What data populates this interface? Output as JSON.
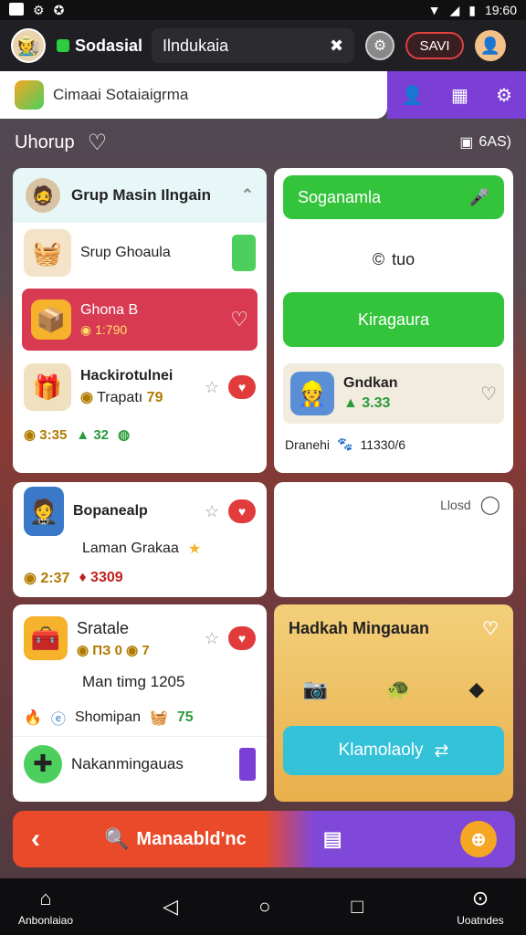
{
  "status": {
    "time": "19:60"
  },
  "appbar": {
    "brand": "Sodasial",
    "search_value": "Ilndukaia",
    "save_label": "SAVI"
  },
  "subbar": {
    "title": "Cimaai Sotaiaigrma"
  },
  "group_row": {
    "label": "Uhorup",
    "count": "6AS)"
  },
  "card1": {
    "header": "Grup Masin Ilngain",
    "row1": "Srup Ghoaula",
    "row2_title": "Ghona B",
    "row2_coin": "1:790",
    "row3_title": "Hackirotulnei",
    "row3_sub": "Trapatı",
    "row3_coin": "79",
    "row3_a": "3:35",
    "row3_b": "32"
  },
  "card2": {
    "button1": "Soganamla",
    "mid_text": "tuo",
    "button2": "Kiragaura",
    "item_title": "Gndkan",
    "item_value": "3.33",
    "footer_label": "Dranehi",
    "footer_value": "11330/6"
  },
  "card3": {
    "title": "Bopanealp",
    "sub": "Laman Grakaa",
    "coin": "2:37",
    "value": "3309"
  },
  "card4": {
    "label": "Llosd"
  },
  "card5": {
    "title": "Sratale",
    "stats_a": "ПЗ 0",
    "stats_b": "7",
    "line1": "Man timg 1205",
    "line2": "Shomipan",
    "line2_value": "75",
    "line3": "Nakanmingauas"
  },
  "card6": {
    "title": "Hadkah Mingauan",
    "button": "Klamolaoly"
  },
  "bottom_bar": {
    "label": "Manaabld",
    "label2": "'nc"
  },
  "nav": {
    "left": "Anbonlaiao",
    "right": "Uoatndes"
  }
}
